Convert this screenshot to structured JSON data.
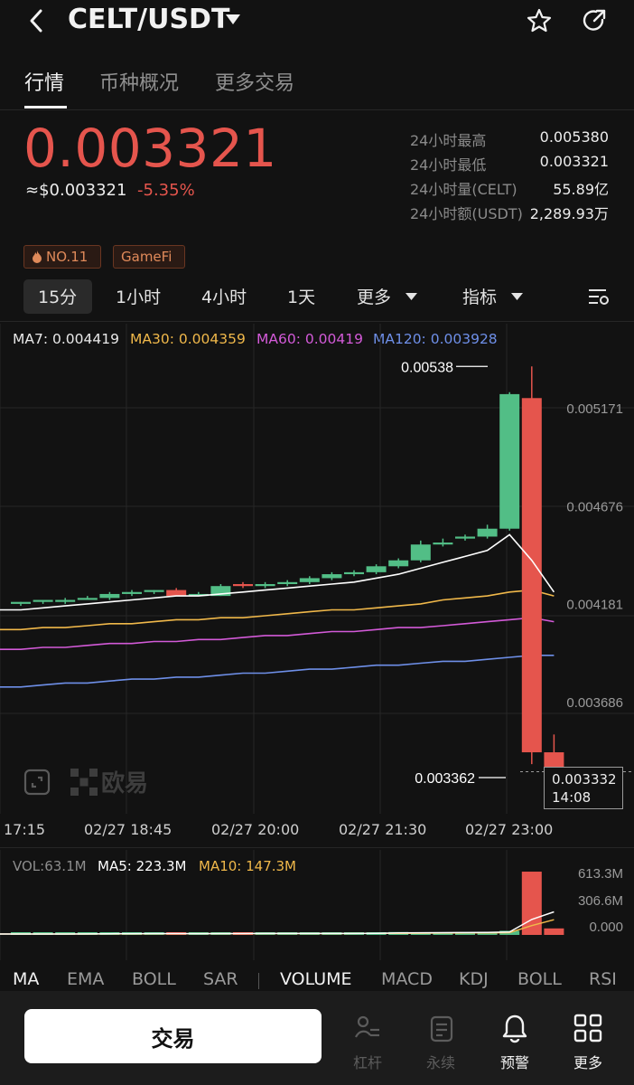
{
  "header": {
    "pair": "CELT/USDT",
    "icons": [
      "back-chevron-icon",
      "caret-down-icon",
      "star-icon",
      "share-icon"
    ]
  },
  "tabs": [
    {
      "label": "行情",
      "active": true
    },
    {
      "label": "币种概况",
      "active": false
    },
    {
      "label": "更多交易",
      "active": false
    }
  ],
  "ticker": {
    "price": "0.003321",
    "usd_price": "≈$0.003321",
    "change": "-5.35%",
    "stats": [
      {
        "label": "24小时最高",
        "value": "0.005380"
      },
      {
        "label": "24小时最低",
        "value": "0.003321"
      },
      {
        "label": "24小时量(CELT)",
        "value": "55.89亿"
      },
      {
        "label": "24小时额(USDT)",
        "value": "2,289.93万"
      }
    ]
  },
  "tags": [
    "NO.11",
    "GameFi"
  ],
  "intervals": {
    "items": [
      "15分",
      "1小时",
      "4小时",
      "1天"
    ],
    "active": "15分",
    "more": "更多",
    "indicators": "指标"
  },
  "ma_legend": [
    {
      "text": "MA7: 0.004419",
      "color": "#ffffff"
    },
    {
      "text": "MA30: 0.004359",
      "color": "#f0b84a"
    },
    {
      "text": "MA60: 0.00419",
      "color": "#d35ad8"
    },
    {
      "text": "MA120: 0.003928",
      "color": "#6e8fe8"
    }
  ],
  "chart_data": {
    "type": "candlestick",
    "y_ticks": [
      "0.005171",
      "0.004676",
      "0.004181",
      "0.003686"
    ],
    "x_ticks": [
      "17:15",
      "02/27 18:45",
      "02/27 20:00",
      "02/27 21:30",
      "02/27 23:00"
    ],
    "high_label": "0.00538",
    "low_label": "0.003362",
    "current_price": "0.003332",
    "countdown": "14:08",
    "candles": [
      {
        "o": 0.00418,
        "h": 0.00419,
        "l": 0.00417,
        "c": 0.00419
      },
      {
        "o": 0.00419,
        "h": 0.0042,
        "l": 0.00418,
        "c": 0.0042
      },
      {
        "o": 0.00419,
        "h": 0.00421,
        "l": 0.00418,
        "c": 0.0042
      },
      {
        "o": 0.0042,
        "h": 0.00422,
        "l": 0.0042,
        "c": 0.00421
      },
      {
        "o": 0.00421,
        "h": 0.00424,
        "l": 0.0042,
        "c": 0.00423
      },
      {
        "o": 0.00423,
        "h": 0.00425,
        "l": 0.00422,
        "c": 0.00424
      },
      {
        "o": 0.00424,
        "h": 0.00425,
        "l": 0.00423,
        "c": 0.00425
      },
      {
        "o": 0.00425,
        "h": 0.00426,
        "l": 0.00422,
        "c": 0.00422
      },
      {
        "o": 0.00422,
        "h": 0.00424,
        "l": 0.00422,
        "c": 0.00423
      },
      {
        "o": 0.00422,
        "h": 0.00428,
        "l": 0.00422,
        "c": 0.00427
      },
      {
        "o": 0.00428,
        "h": 0.00429,
        "l": 0.00426,
        "c": 0.00427
      },
      {
        "o": 0.00427,
        "h": 0.00429,
        "l": 0.00426,
        "c": 0.00428
      },
      {
        "o": 0.00428,
        "h": 0.0043,
        "l": 0.00427,
        "c": 0.00429
      },
      {
        "o": 0.00429,
        "h": 0.00432,
        "l": 0.00428,
        "c": 0.00431
      },
      {
        "o": 0.00431,
        "h": 0.00434,
        "l": 0.0043,
        "c": 0.00433
      },
      {
        "o": 0.00433,
        "h": 0.00435,
        "l": 0.00432,
        "c": 0.00434
      },
      {
        "o": 0.00434,
        "h": 0.00438,
        "l": 0.00433,
        "c": 0.00437
      },
      {
        "o": 0.00437,
        "h": 0.00441,
        "l": 0.00436,
        "c": 0.0044
      },
      {
        "o": 0.0044,
        "h": 0.0045,
        "l": 0.00439,
        "c": 0.00448
      },
      {
        "o": 0.00448,
        "h": 0.00451,
        "l": 0.00447,
        "c": 0.00449
      },
      {
        "o": 0.00451,
        "h": 0.00453,
        "l": 0.0045,
        "c": 0.00452
      },
      {
        "o": 0.00452,
        "h": 0.00458,
        "l": 0.00451,
        "c": 0.00456
      },
      {
        "o": 0.00456,
        "h": 0.00525,
        "l": 0.00455,
        "c": 0.00524
      },
      {
        "o": 0.00522,
        "h": 0.00538,
        "l": 0.00337,
        "c": 0.00343
      },
      {
        "o": 0.00343,
        "h": 0.00352,
        "l": 0.00332,
        "c": 0.00333
      }
    ],
    "ma7": [
      0.00415,
      0.00416,
      0.00417,
      0.00418,
      0.00419,
      0.0042,
      0.00421,
      0.00422,
      0.00422,
      0.00423,
      0.00424,
      0.00425,
      0.00426,
      0.00427,
      0.00428,
      0.00429,
      0.00431,
      0.00433,
      0.00436,
      0.00439,
      0.00442,
      0.00445,
      0.00453,
      0.0044,
      0.00424
    ],
    "ma30": [
      0.00405,
      0.00406,
      0.00406,
      0.00407,
      0.00408,
      0.00408,
      0.00409,
      0.0041,
      0.0041,
      0.00411,
      0.00411,
      0.00412,
      0.00413,
      0.00414,
      0.00415,
      0.00415,
      0.00416,
      0.00417,
      0.00418,
      0.0042,
      0.00421,
      0.00422,
      0.00424,
      0.00425,
      0.00422
    ],
    "ma60": [
      0.00395,
      0.00396,
      0.00396,
      0.00397,
      0.00398,
      0.00398,
      0.00399,
      0.00399,
      0.004,
      0.004,
      0.00401,
      0.00402,
      0.00402,
      0.00403,
      0.00404,
      0.00404,
      0.00405,
      0.00406,
      0.00406,
      0.00407,
      0.00408,
      0.00409,
      0.0041,
      0.00411,
      0.00409
    ],
    "ma120": [
      0.00376,
      0.00377,
      0.00378,
      0.00378,
      0.00379,
      0.0038,
      0.0038,
      0.00381,
      0.00381,
      0.00382,
      0.00383,
      0.00383,
      0.00384,
      0.00385,
      0.00385,
      0.00386,
      0.00387,
      0.00387,
      0.00388,
      0.00389,
      0.00389,
      0.0039,
      0.00391,
      0.00392,
      0.00392
    ]
  },
  "volume": {
    "legend": [
      {
        "text": "VOL:63.1M",
        "color": "#8d8d8d"
      },
      {
        "text": "MA5: 223.3M",
        "color": "#ffffff"
      },
      {
        "text": "MA10: 147.3M",
        "color": "#f0b84a"
      }
    ],
    "y_ticks": [
      "613.3M",
      "306.6M",
      "0.000"
    ],
    "bars": [
      8,
      9,
      8,
      10,
      14,
      16,
      12,
      10,
      9,
      20,
      14,
      12,
      10,
      12,
      14,
      18,
      25,
      28,
      18,
      22,
      24,
      30,
      40,
      613,
      63
    ],
    "ma5": [
      9,
      9,
      9,
      10,
      11,
      12,
      13,
      13,
      12,
      13,
      13,
      14,
      14,
      14,
      14,
      14,
      16,
      19,
      21,
      22,
      23,
      24,
      28,
      150,
      223
    ],
    "ma10": [
      9,
      9,
      9,
      9,
      10,
      10,
      11,
      11,
      12,
      12,
      12,
      13,
      13,
      13,
      13,
      14,
      15,
      16,
      17,
      18,
      19,
      20,
      22,
      90,
      147
    ]
  },
  "indicator_tabs": {
    "main": [
      "MA",
      "EMA",
      "BOLL",
      "SAR"
    ],
    "sub": [
      "VOLUME",
      "MACD",
      "KDJ",
      "BOLL",
      "RSI"
    ],
    "active_main": "MA",
    "active_sub": "VOLUME"
  },
  "watermark": {
    "brand": "欧易"
  },
  "bottom_nav": {
    "trade_button": "交易",
    "items": [
      {
        "label": "杠杆",
        "icon": "leverage-icon",
        "enabled": false
      },
      {
        "label": "永续",
        "icon": "perpetual-icon",
        "enabled": false
      },
      {
        "label": "预警",
        "icon": "bell-icon",
        "enabled": true
      },
      {
        "label": "更多",
        "icon": "grid-icon",
        "enabled": true
      }
    ]
  },
  "colors": {
    "up": "#52be86",
    "down": "#e5554d",
    "bg": "#121212"
  }
}
